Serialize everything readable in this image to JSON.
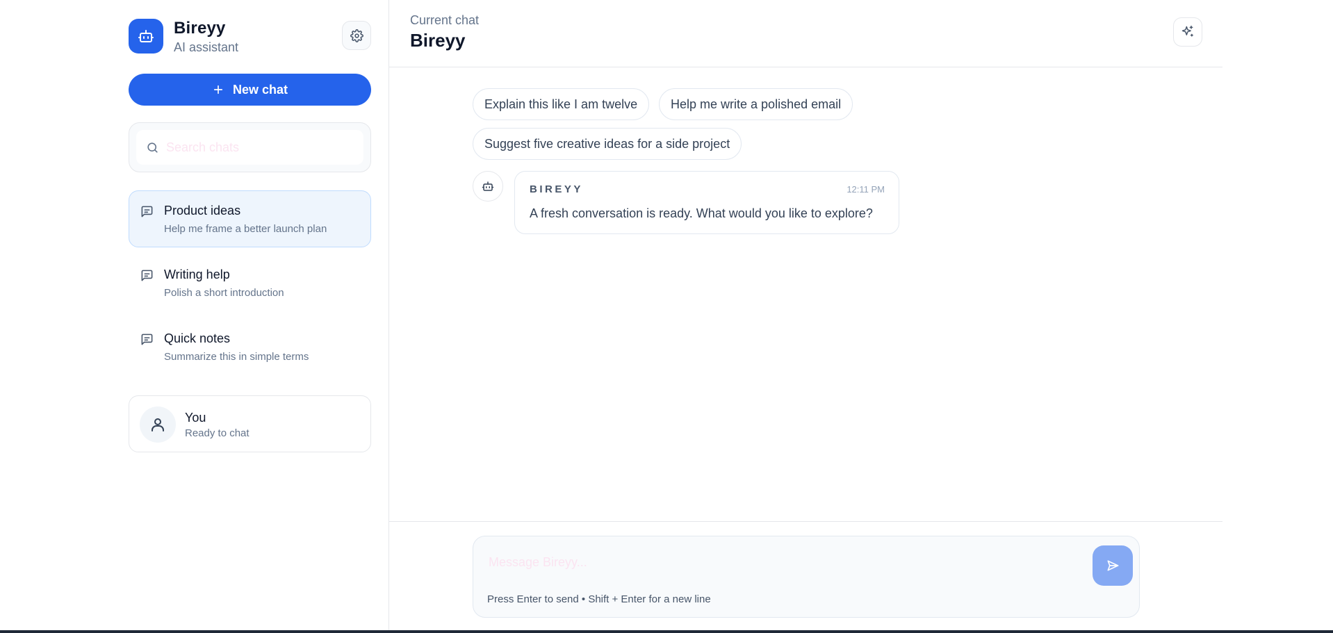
{
  "sidebar": {
    "brand": {
      "name": "Bireyy",
      "subtitle": "AI assistant"
    },
    "new_chat_label": "New chat",
    "search": {
      "placeholder": "Search chats"
    },
    "chats": [
      {
        "title": "Product ideas",
        "subtitle": "Help me frame a better launch plan",
        "active": true
      },
      {
        "title": "Writing help",
        "subtitle": "Polish a short introduction",
        "active": false
      },
      {
        "title": "Quick notes",
        "subtitle": "Summarize this in simple terms",
        "active": false
      }
    ],
    "user": {
      "name": "You",
      "status": "Ready to chat"
    }
  },
  "header": {
    "label": "Current chat",
    "title": "Bireyy"
  },
  "suggestions": [
    "Explain this like I am twelve",
    "Help me write a polished email",
    "Suggest five creative ideas for a side project"
  ],
  "messages": [
    {
      "sender": "BIREYY",
      "time": "12:11 PM",
      "text": "A fresh conversation is ready. What would you like to explore?"
    }
  ],
  "composer": {
    "placeholder": "Message Bireyy...",
    "hint": "Press Enter to send • Shift + Enter for a new line"
  },
  "icons": {
    "brand": "robot-icon",
    "settings": "gear-icon",
    "new_chat": "plus-icon",
    "search": "search-icon",
    "chat": "chat-bubble-icon",
    "user": "user-icon",
    "sparkle": "sparkles-icon",
    "bot": "robot-icon",
    "send": "send-icon"
  },
  "colors": {
    "accent": "#2563eb",
    "accent_soft": "#85a9f3",
    "active_item_bg": "#eef5fd",
    "text_primary": "#0f172a",
    "text_muted": "#64748b"
  }
}
